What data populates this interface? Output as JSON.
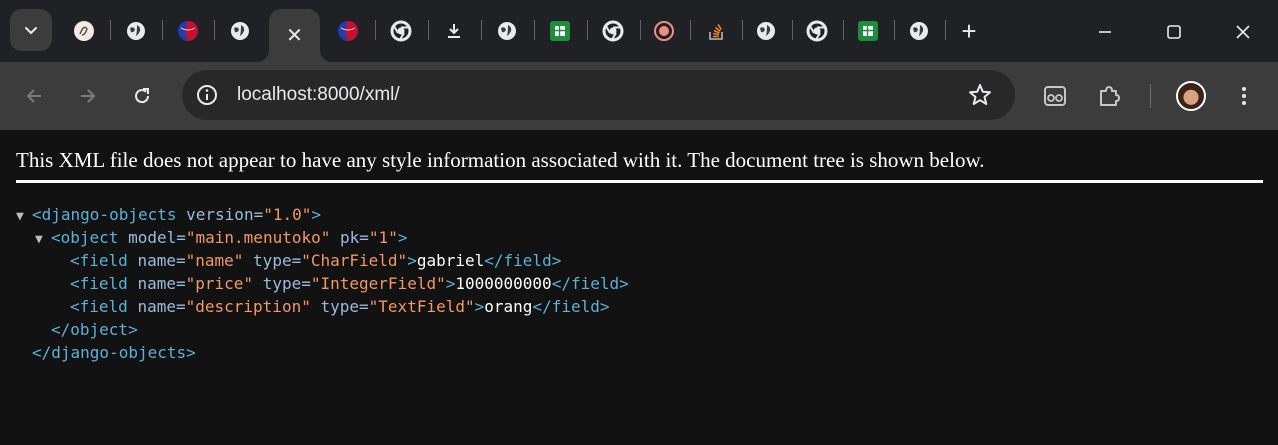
{
  "browser": {
    "tabs": [
      {
        "icon": "tab-search-icon"
      },
      {
        "icon": "sketch-favicon-icon"
      },
      {
        "icon": "globe-icon"
      },
      {
        "icon": "red-blue-ball-favicon-icon"
      },
      {
        "icon": "globe-icon"
      },
      {
        "icon": "close-icon",
        "active": true
      },
      {
        "icon": "red-blue-ball-favicon-icon"
      },
      {
        "icon": "chrome-icon"
      },
      {
        "icon": "download-icon"
      },
      {
        "icon": "globe-icon"
      },
      {
        "icon": "google-sheets-icon"
      },
      {
        "icon": "chrome-icon"
      },
      {
        "icon": "record-icon"
      },
      {
        "icon": "stackoverflow-icon"
      },
      {
        "icon": "globe-icon"
      },
      {
        "icon": "chrome-icon"
      },
      {
        "icon": "google-sheets-icon"
      },
      {
        "icon": "globe-icon"
      }
    ],
    "new_tab_label": "+",
    "address": {
      "url": "localhost:8000/xml/"
    }
  },
  "page": {
    "notice": "This XML file does not appear to have any style information associated with it. The document tree is shown below.",
    "xml": {
      "root_open_tag": "<django-objects",
      "root_attr_name": "version=",
      "root_attr_value": "\"1.0\"",
      "root_open_close": ">",
      "object_open_tag": "<object",
      "object_attr1_name": "model=",
      "object_attr1_value": "\"main.menutoko\"",
      "object_attr2_name": "pk=",
      "object_attr2_value": "\"1\"",
      "object_open_close": ">",
      "fields": [
        {
          "open": "<field",
          "name_attr": "name=",
          "name_val": "\"name\"",
          "type_attr": "type=",
          "type_val": "\"CharField\"",
          "gt": ">",
          "text": "gabriel",
          "close": "</field>"
        },
        {
          "open": "<field",
          "name_attr": "name=",
          "name_val": "\"price\"",
          "type_attr": "type=",
          "type_val": "\"IntegerField\"",
          "gt": ">",
          "text": "1000000000",
          "close": "</field>"
        },
        {
          "open": "<field",
          "name_attr": "name=",
          "name_val": "\"description\"",
          "type_attr": "type=",
          "type_val": "\"TextField\"",
          "gt": ">",
          "text": "orang",
          "close": "</field>"
        }
      ],
      "object_close": "</object>",
      "root_close": "</django-objects>",
      "collapse_glyph": "▼"
    }
  },
  "colors": {
    "tag": "#5db0d7",
    "attr_name": "#9bbbdc",
    "attr_value": "#f29766",
    "text": "#ffffff"
  }
}
